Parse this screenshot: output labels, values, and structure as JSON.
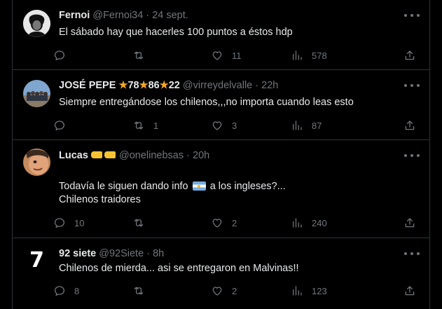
{
  "tweets": [
    {
      "name": "Fernoi",
      "handle": "@Fernoi34",
      "sep": "·",
      "time": "24 sept.",
      "text": "El sábado hay que hacerles 100 puntos a éstos hdp",
      "reply_count": "",
      "retweet_count": "",
      "like_count": "11",
      "view_count": "578"
    },
    {
      "name": "JOSÉ PEPE",
      "name_parts": [
        "78",
        "86",
        "22"
      ],
      "handle": "@virreydelvalle",
      "sep": "·",
      "time": "22h",
      "text": "Siempre entregándose los chilenos,,,no importa cuando leas esto",
      "reply_count": "",
      "retweet_count": "1",
      "like_count": "3",
      "view_count": "87"
    },
    {
      "name": "Lucas",
      "handle": "@onelinebsas",
      "sep": "·",
      "time": "20h",
      "text_before_flag": "Todavía le siguen dando info",
      "text_after_flag": "a los ingleses?...",
      "text_line2": "Chilenos traidores",
      "reply_count": "10",
      "retweet_count": "",
      "like_count": "2",
      "view_count": "240"
    },
    {
      "name": "92 siete",
      "handle": "@92Siete",
      "sep": "·",
      "time": "8h",
      "avatar_text": "7",
      "text": "Chilenos de mierda... asi se entregaron en Malvinas!!",
      "reply_count": "8",
      "retweet_count": "",
      "like_count": "2",
      "view_count": "123"
    }
  ],
  "icons": [
    "reply-icon",
    "retweet-icon",
    "like-icon",
    "views-icon",
    "share-icon",
    "more-icon",
    "star-emoji",
    "argentina-flag-emoji",
    "pointing-hands-emoji"
  ],
  "colors": {
    "background": "#000000",
    "text": "#e7e9ea",
    "muted": "#71767b",
    "border": "#2f3336"
  }
}
